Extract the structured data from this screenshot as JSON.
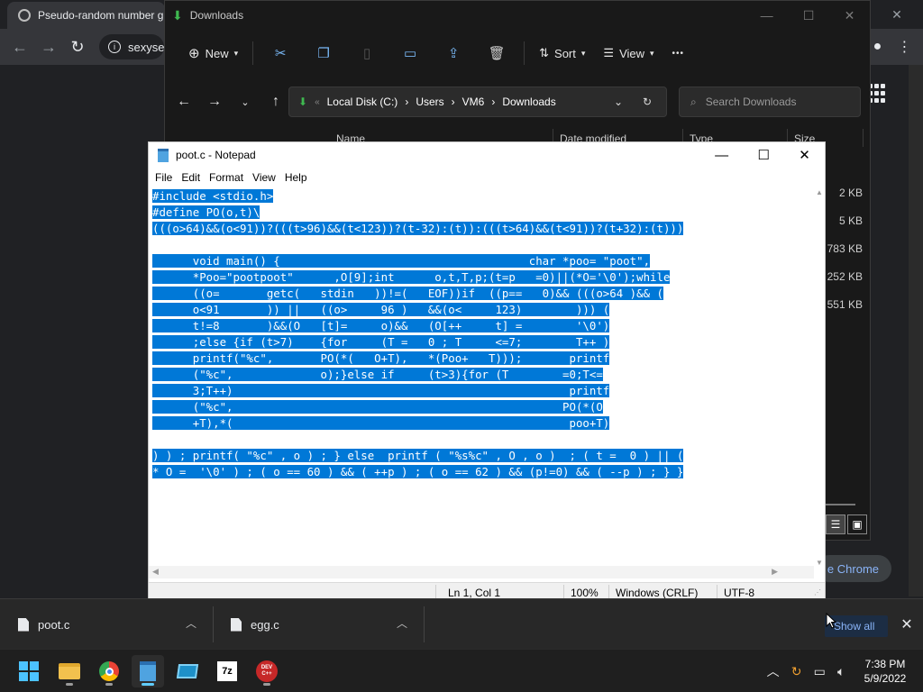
{
  "chrome": {
    "tab_title": "Pseudo-random number g",
    "omnibox_text": "sexyse",
    "cta_label": "e Chrome"
  },
  "explorer": {
    "title": "Downloads",
    "commands": {
      "new": "New",
      "sort": "Sort",
      "view": "View",
      "more": "•••"
    },
    "breadcrumb": [
      "Local Disk (C:)",
      "Users",
      "VM6",
      "Downloads"
    ],
    "search_placeholder": "Search Downloads",
    "columns": {
      "name": "Name",
      "date_modified": "Date modified",
      "type": "Type",
      "size": "Size"
    },
    "file_sizes": [
      "2 KB",
      "5 KB",
      "783 KB",
      "252 KB",
      "551 KB"
    ]
  },
  "notepad": {
    "title": "poot.c - Notepad",
    "menu": [
      "File",
      "Edit",
      "Format",
      "View",
      "Help"
    ],
    "lines": [
      "#include <stdio.h>",
      "#define PO(o,t)\\",
      "(((o>64)&&(o<91))?(((t>96)&&(t<123))?(t-32):(t)):(((t>64)&&(t<91))?(t+32):(t)))",
      "",
      "      void main() {                                     char *poo= \"poot\",",
      "      *Poo=\"pootpoot\"      ,O[9];int      o,t,T,p;(t=p   =0)||(*O='\\0');while",
      "      ((o=       getc(   stdin   ))!=(   EOF))if  ((p==   0)&& (((o>64 )&& (",
      "      o<91       )) ||   ((o>     96 )   &&(o<     123)        ))) (",
      "      t!=8       )&&(O   [t]=     o)&&   (O[++     t] =        '\\0')",
      "      ;else {if (t>7)    {for     (T =   0 ; T     <=7;        T++ )",
      "      printf(\"%c\",       PO(*(   O+T),   *(Poo+   T)));       printf",
      "      (\"%c\",             o);}else if     (t>3){for (T        =0;T<=",
      "      3;T++)                                                  printf",
      "      (\"%c\",                                                 PO(*(O",
      "      +T),*(                                                  poo+T)",
      "",
      ") ) ; printf( \"%c\" , o ) ; } else  printf ( \"%s%c\" , O , o )  ; ( t =  0 ) || (",
      "* O =  '\\0' ) ; ( o == 60 ) && ( ++p ) ; ( o == 62 ) && (p!=0) && ( --p ) ; } }"
    ],
    "status": {
      "position": "Ln 1, Col 1",
      "zoom": "100%",
      "line_ending": "Windows (CRLF)",
      "encoding": "UTF-8"
    }
  },
  "downloads_shelf": {
    "items": [
      "poot.c",
      "egg.c"
    ],
    "show_all": "Show all"
  },
  "taskbar": {
    "time": "7:38 PM",
    "date": "5/9/2022",
    "app_7zip_label": "7z",
    "app_devcpp_label": "DEV C++"
  },
  "colors": {
    "selection": "#0078d7",
    "accent": "#60cdff",
    "folder": "#f2c14e"
  }
}
